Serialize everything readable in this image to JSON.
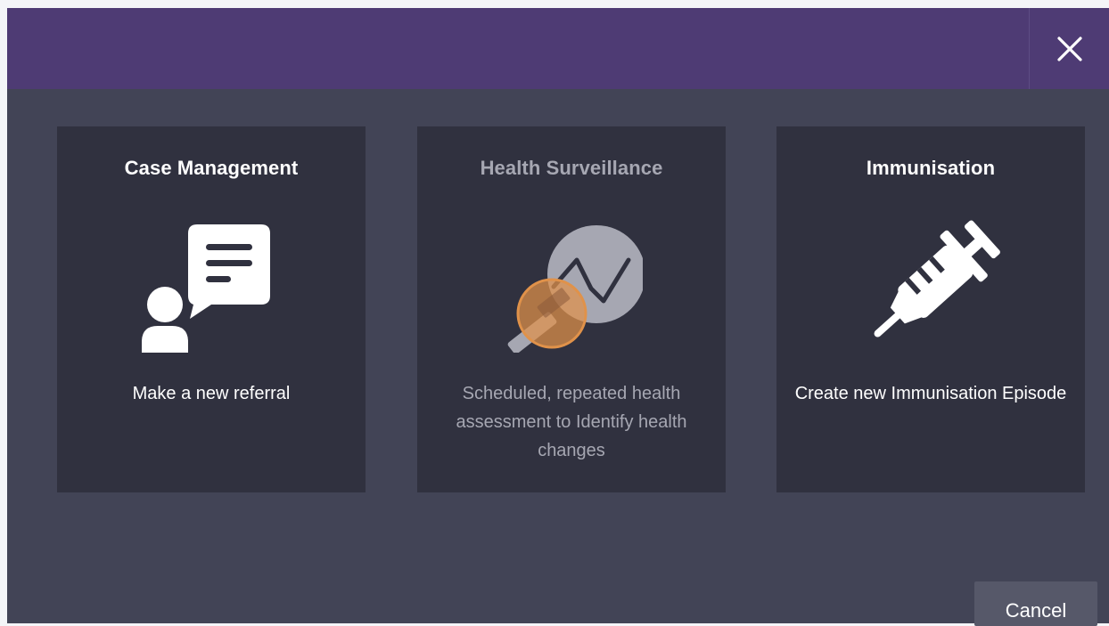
{
  "header": {
    "close_icon": "close-icon",
    "colors": {
      "header_background": "#4e3b74",
      "body_background": "#424456",
      "card_background": "#30313f",
      "highlight": "#e0924a"
    }
  },
  "cards": [
    {
      "title": "Case Management",
      "description": "Make a new referral",
      "icon": "referral-chat-icon",
      "enabled": true
    },
    {
      "title": "Health Surveillance",
      "description": "Scheduled, repeated health assessment to Identify health changes",
      "icon": "health-surveillance-chart-icon",
      "enabled": false
    },
    {
      "title": "Immunisation",
      "description": "Create new Immunisation Episode",
      "icon": "syringe-icon",
      "enabled": true
    }
  ],
  "footer": {
    "cancel_label": "Cancel"
  }
}
